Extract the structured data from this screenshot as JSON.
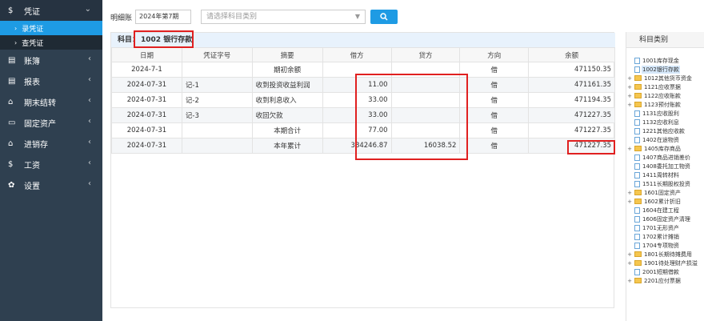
{
  "sidebar": {
    "items": [
      {
        "name": "voucher",
        "icon": "$",
        "label": "凭证",
        "open": true
      },
      {
        "name": "books",
        "icon": "▤",
        "label": "账簿"
      },
      {
        "name": "reports",
        "icon": "▤",
        "label": "报表"
      },
      {
        "name": "period-close",
        "icon": "⌂",
        "label": "期末结转"
      },
      {
        "name": "fixed-assets",
        "icon": "▭",
        "label": "固定资产"
      },
      {
        "name": "inventory",
        "icon": "⌂",
        "label": "进销存"
      },
      {
        "name": "wages",
        "icon": "$",
        "label": "工资"
      },
      {
        "name": "settings",
        "icon": "✿",
        "label": "设置"
      }
    ],
    "voucher_sub": [
      {
        "label": "录凭证",
        "active": true
      },
      {
        "label": "查凭证",
        "active": false
      }
    ]
  },
  "toolbar": {
    "ledger_label": "明细账",
    "period_value": "2024年第7期",
    "subject_placeholder": "请选择科目类别"
  },
  "subject": {
    "prefix": "科目：",
    "code_name": "1002  银行存款"
  },
  "table": {
    "headers": [
      "日期",
      "凭证字号",
      "摘要",
      "借方",
      "贷方",
      "方向",
      "余额"
    ],
    "rows": [
      {
        "date": "2024-7-1",
        "voucher": "",
        "summary": "期初余额",
        "debit": "",
        "credit": "",
        "direction": "借",
        "balance": "471150.35"
      },
      {
        "date": "2024-07-31",
        "voucher": "记-1",
        "summary": "收到投资收益利润",
        "debit": "11.00",
        "credit": "",
        "direction": "借",
        "balance": "471161.35"
      },
      {
        "date": "2024-07-31",
        "voucher": "记-2",
        "summary": "收到利息收入",
        "debit": "33.00",
        "credit": "",
        "direction": "借",
        "balance": "471194.35"
      },
      {
        "date": "2024-07-31",
        "voucher": "记-3",
        "summary": "收回欠款",
        "debit": "33.00",
        "credit": "",
        "direction": "借",
        "balance": "471227.35"
      },
      {
        "date": "2024-07-31",
        "voucher": "",
        "summary": "本期合计",
        "debit": "77.00",
        "credit": "",
        "direction": "借",
        "balance": "471227.35"
      },
      {
        "date": "2024-07-31",
        "voucher": "",
        "summary": "本年累计",
        "debit": "384246.87",
        "credit": "16038.52",
        "direction": "借",
        "balance": "471227.35"
      }
    ]
  },
  "tree": {
    "header": "科目类别",
    "items": [
      {
        "label": "1001库存现金",
        "type": "file"
      },
      {
        "label": "1002银行存款",
        "type": "file",
        "selected": true
      },
      {
        "label": "1012其他货币资金",
        "type": "folder"
      },
      {
        "label": "1121应收票据",
        "type": "folder"
      },
      {
        "label": "1122应收账款",
        "type": "folder"
      },
      {
        "label": "1123预付账款",
        "type": "folder"
      },
      {
        "label": "1131应收股利",
        "type": "file"
      },
      {
        "label": "1132应收利息",
        "type": "file"
      },
      {
        "label": "1221其他应收款",
        "type": "file"
      },
      {
        "label": "1402在途物资",
        "type": "file"
      },
      {
        "label": "1405库存商品",
        "type": "folder"
      },
      {
        "label": "1407商品进销差价",
        "type": "file"
      },
      {
        "label": "1408委托加工物资",
        "type": "file"
      },
      {
        "label": "1411周转材料",
        "type": "file"
      },
      {
        "label": "1511长期股权投资",
        "type": "file"
      },
      {
        "label": "1601固定资产",
        "type": "folder"
      },
      {
        "label": "1602累计折旧",
        "type": "folder"
      },
      {
        "label": "1604在建工程",
        "type": "file"
      },
      {
        "label": "1606固定资产清理",
        "type": "file"
      },
      {
        "label": "1701无形资产",
        "type": "file"
      },
      {
        "label": "1702累计摊销",
        "type": "file"
      },
      {
        "label": "1704专项物资",
        "type": "file"
      },
      {
        "label": "1801长期待摊费用",
        "type": "folder"
      },
      {
        "label": "1901待处理财产损溢",
        "type": "folder"
      },
      {
        "label": "2001短期借款",
        "type": "file"
      },
      {
        "label": "2201应付票据",
        "type": "folder"
      }
    ]
  },
  "colors": {
    "sidebar_bg": "#2f4050",
    "accent": "#1e9be4",
    "annotation_red": "#e02020"
  }
}
